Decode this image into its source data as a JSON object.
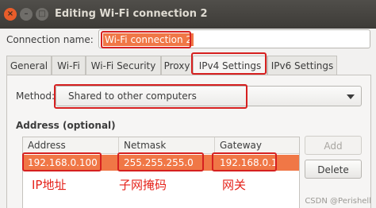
{
  "window": {
    "title": "Editing Wi-Fi connection 2",
    "close_glyph": "×",
    "min_glyph": "–",
    "max_glyph": "□"
  },
  "connection": {
    "name_label": "Connection name:",
    "name_value": "Wi-Fi connection 2"
  },
  "tabs": [
    {
      "label": "General",
      "active": false
    },
    {
      "label": "Wi-Fi",
      "active": false
    },
    {
      "label": "Wi-Fi Security",
      "active": false
    },
    {
      "label": "Proxy",
      "active": false
    },
    {
      "label": "IPv4 Settings",
      "active": true
    },
    {
      "label": "IPv6 Settings",
      "active": false
    }
  ],
  "method": {
    "label": "Method:",
    "value": "Shared to other computers"
  },
  "address_section": {
    "title": "Address (optional)",
    "columns": [
      "Address",
      "Netmask",
      "Gateway"
    ],
    "rows": [
      {
        "address": "192.168.0.100",
        "netmask": "255.255.255.0",
        "gateway": "192.168.0.1"
      }
    ]
  },
  "buttons": {
    "add": "Add",
    "delete": "Delete"
  },
  "annotations": {
    "ip": "IP地址",
    "netmask": "子网掩码",
    "gateway": "网关"
  },
  "watermark": "CSDN @Perishell",
  "colors": {
    "highlight": "#f07746",
    "annotation": "#e5231b",
    "titlebar": "#3d3b37",
    "close_button": "#e95d2a"
  }
}
